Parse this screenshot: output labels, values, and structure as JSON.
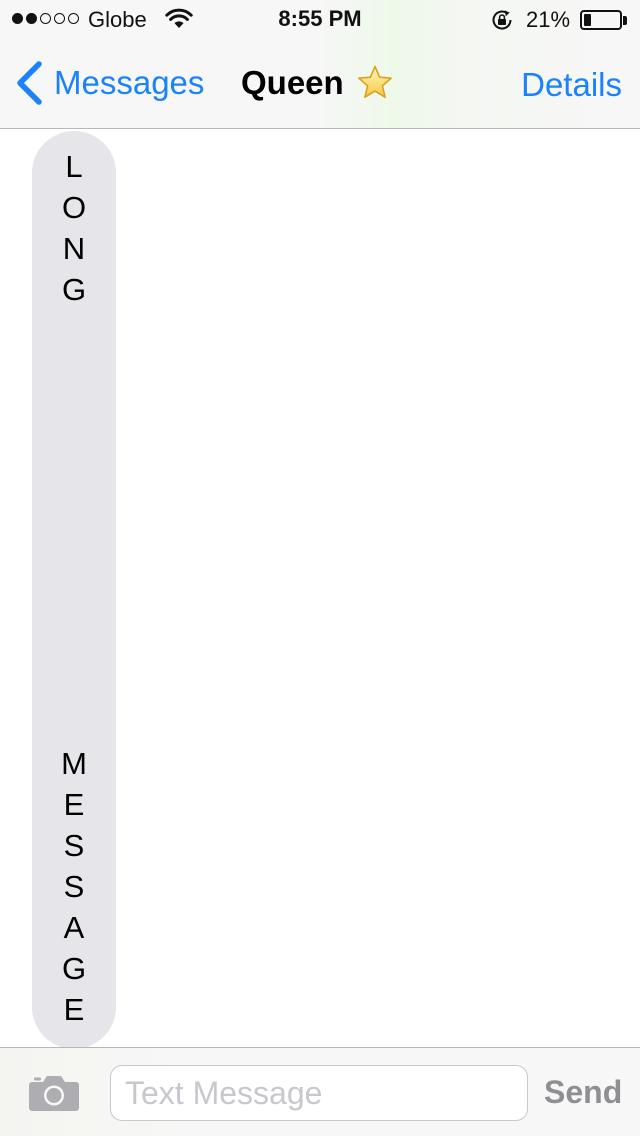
{
  "status_bar": {
    "signal_total": 5,
    "signal_filled": 2,
    "carrier": "Globe",
    "time": "8:55 PM",
    "battery_percent_label": "21%",
    "battery_level": 0.21,
    "icons": [
      "signal-dots-icon",
      "wifi-icon",
      "rotation-lock-icon",
      "battery-icon"
    ]
  },
  "nav": {
    "back_label": "Messages",
    "title": "Queen",
    "title_emoji_icon": "star-icon",
    "details_label": "Details"
  },
  "conversation": {
    "message_letters": [
      "L",
      "O",
      "N",
      "G",
      "M",
      "E",
      "S",
      "S",
      "A",
      "G",
      "E"
    ],
    "bubble_color": "#e5e5ea"
  },
  "composer": {
    "camera_icon": "camera-icon",
    "placeholder": "Text Message",
    "value": "",
    "send_label": "Send"
  },
  "colors": {
    "accent": "#1a82fb",
    "disabled_send": "#8e8e93"
  }
}
